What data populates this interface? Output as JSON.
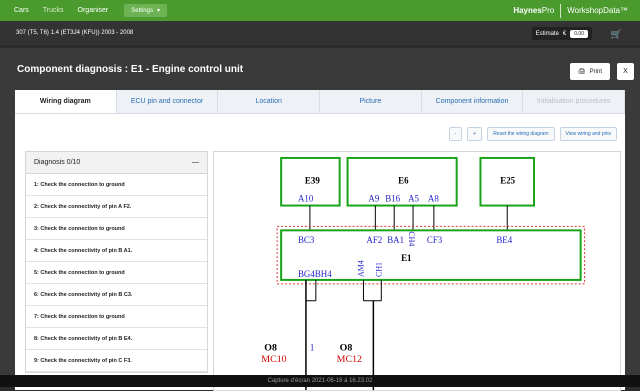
{
  "topnav": {
    "items": [
      "Cars",
      "Trucks",
      "Organiser"
    ],
    "settings_label": "Settings",
    "brand_haynes": "Haynes",
    "brand_pro": "Pro",
    "brand_workshop": "WorkshopData™"
  },
  "vehicle": {
    "title": "307 (T5, T6) 1.4 (ET3J4 (KFU)) 2003 - 2008"
  },
  "estimate": {
    "label": "Estimate",
    "currency": "€",
    "value": "0.00"
  },
  "dialog": {
    "title": "Component diagnosis : E1 - Engine control unit",
    "print_label": "Print",
    "close_label": "X"
  },
  "tabs": [
    "Wiring diagram",
    "ECU pin and connector",
    "Location",
    "Picture",
    "Component information",
    "Initialisation procedures"
  ],
  "tools": {
    "minus": "-",
    "plus": "+",
    "reset": "Reset the wiring diagram",
    "view": "View wiring and pins"
  },
  "diagnosis": {
    "header": "Diagnosis 0/10",
    "collapse": "—",
    "items": [
      "1: Check the connection to ground",
      "2: Check the connectivity of pin A F2.",
      "3: Check the connection to ground",
      "4: Check the connectivity of pin B A1.",
      "5: Check the connection to ground",
      "6: Check the connectivity of pin B C3.",
      "7: Check the connection to ground",
      "8: Check the connectivity of pin B E4.",
      "9: Check the connectivity of pin C F3."
    ]
  },
  "diagram": {
    "e39": "E39",
    "e6": "E6",
    "e25": "E25",
    "e1": "E1",
    "pin_a10": "A10",
    "pin_a9": "A9",
    "pin_b16": "B16",
    "pin_a5": "A5",
    "pin_a8": "A8",
    "pin_bc3": "BC3",
    "pin_af2": "AF2",
    "pin_ba1": "BA1",
    "pin_ch4": "CH4",
    "pin_cf3": "CF3",
    "pin_be4": "BE4",
    "pin_am4": "AM4",
    "pin_ch1": "CH1",
    "pin_bg4bh4": "BG4BH4",
    "o8a": "O8",
    "mc10": "MC10",
    "wire1": "1",
    "o8b": "O8",
    "mc12": "MC12"
  },
  "status": "Capture d'écran 2021-06-16 à 16.23.02"
}
